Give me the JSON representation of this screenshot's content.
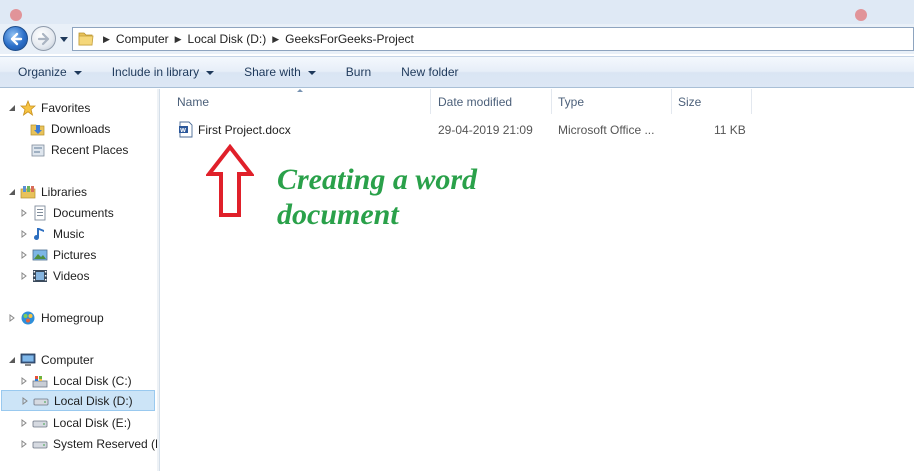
{
  "address_bar": {
    "crumbs": [
      "Computer",
      "Local Disk (D:)",
      "GeeksForGeeks-Project"
    ]
  },
  "toolbar": {
    "organize": "Organize",
    "include_in_library": "Include in library",
    "share_with": "Share with",
    "burn": "Burn",
    "new_folder": "New folder"
  },
  "nav": {
    "favorites": "Favorites",
    "downloads": "Downloads",
    "recent_places": "Recent Places",
    "libraries": "Libraries",
    "documents": "Documents",
    "music": "Music",
    "pictures": "Pictures",
    "videos": "Videos",
    "homegroup": "Homegroup",
    "computer": "Computer",
    "disk_c": "Local Disk (C:)",
    "disk_d": "Local Disk (D:)",
    "disk_e": "Local Disk (E:)",
    "system_reserved": "System Reserved (H:"
  },
  "columns": {
    "name": "Name",
    "date_modified": "Date modified",
    "type": "Type",
    "size": "Size"
  },
  "files": [
    {
      "name": "First Project.docx",
      "date_modified": "29-04-2019 21:09",
      "type": "Microsoft Office ...",
      "size": "11 KB",
      "icon": "word-document-icon"
    }
  ],
  "annotation": {
    "line1": "Creating a word",
    "line2": "document",
    "color": "#2aa14a",
    "arrow_color": "#e0202a"
  }
}
